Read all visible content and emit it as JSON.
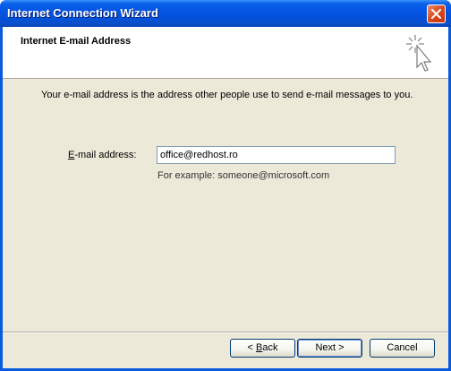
{
  "window": {
    "title": "Internet Connection Wizard",
    "close_icon": "close-icon"
  },
  "header": {
    "title": "Internet E-mail Address",
    "icon": "wizard-sparkle-cursor-icon"
  },
  "main": {
    "description": "Your e-mail address is the address other people use to send e-mail messages to you.",
    "email_label": "E-mail address:",
    "email_label_accel": "E",
    "email_label_rest": "-mail address:",
    "email_value": "office@redhost.ro",
    "example_text": "For example: someone@microsoft.com"
  },
  "buttons": {
    "back_prefix": "< ",
    "back_accel": "B",
    "back_rest": "ack",
    "next_label": "Next >",
    "cancel_label": "Cancel"
  },
  "colors": {
    "titlebar": "#0554e3",
    "dialog_background": "#ece9d8",
    "header_background": "#ffffff",
    "close_button": "#d84a1f"
  }
}
